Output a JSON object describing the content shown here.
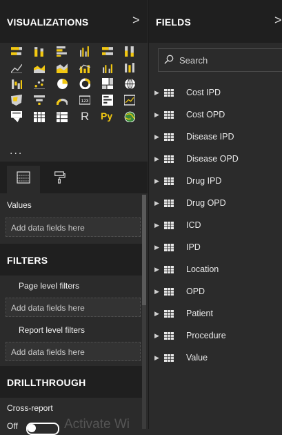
{
  "visualizations_panel": {
    "title": "VISUALIZATIONS",
    "collapse_glyph": ">",
    "more_label": "...",
    "icons": [
      "stacked-bar-chart-icon",
      "stacked-column-chart-icon",
      "clustered-bar-chart-icon",
      "clustered-column-chart-icon",
      "100pct-stacked-bar-icon",
      "100pct-stacked-column-icon",
      "line-chart-icon",
      "area-chart-icon",
      "stacked-area-chart-icon",
      "line-and-column-chart-icon",
      "line-and-clustered-column-icon",
      "ribbon-chart-icon",
      "waterfall-chart-icon",
      "scatter-chart-icon",
      "pie-chart-icon",
      "donut-chart-icon",
      "treemap-icon",
      "map-icon",
      "filled-map-icon",
      "funnel-icon",
      "gauge-icon",
      "card-icon",
      "multi-row-card-icon",
      "kpi-icon",
      "slicer-icon",
      "table-icon",
      "matrix-icon",
      "r-script-visual-icon",
      "python-visual-icon",
      "globe-icon"
    ],
    "r_label": "R",
    "py_label": "Py",
    "tabs": [
      "fields-tab-icon",
      "format-tab-icon"
    ],
    "values_label": "Values",
    "values_placeholder": "Add data fields here"
  },
  "filters": {
    "title": "FILTERS",
    "page_level_label": "Page level filters",
    "page_level_placeholder": "Add data fields here",
    "report_level_label": "Report level filters",
    "report_level_placeholder": "Add data fields here"
  },
  "drillthrough": {
    "title": "DRILLTHROUGH",
    "cross_report_label": "Cross-report",
    "toggle_label": "Off",
    "watermark": "Activate Wi"
  },
  "fields_panel": {
    "title": "FIELDS",
    "collapse_glyph": ">",
    "search_placeholder": "Search",
    "tables": [
      {
        "name": "Cost IPD"
      },
      {
        "name": "Cost OPD"
      },
      {
        "name": "Disease IPD"
      },
      {
        "name": "Disease OPD"
      },
      {
        "name": "Drug IPD"
      },
      {
        "name": "Drug OPD"
      },
      {
        "name": "ICD"
      },
      {
        "name": "IPD"
      },
      {
        "name": "Location"
      },
      {
        "name": "OPD"
      },
      {
        "name": "Patient"
      },
      {
        "name": "Procedure"
      },
      {
        "name": "Value"
      }
    ]
  },
  "colors": {
    "accent_yellow": "#f2c811",
    "panel_bg": "#2b2b2b",
    "header_bg": "#1f1f1f"
  }
}
